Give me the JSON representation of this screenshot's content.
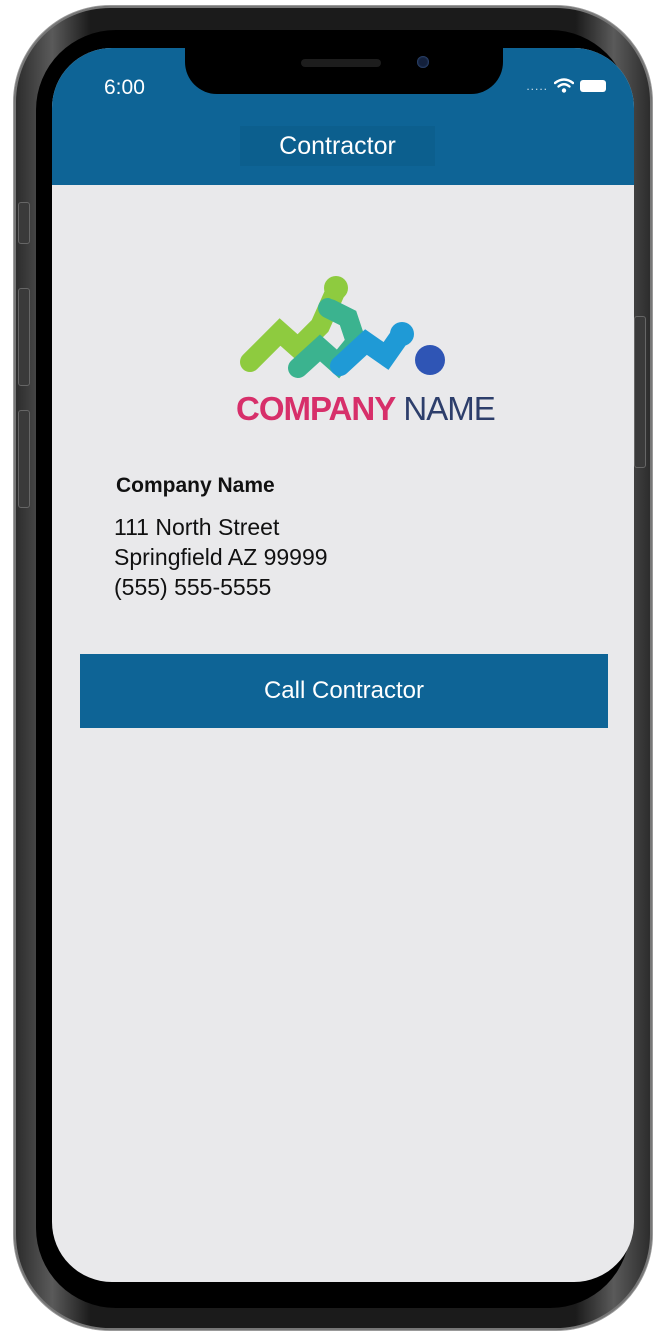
{
  "status_bar": {
    "time": "6:00",
    "signal_dots": "....."
  },
  "header": {
    "title": "Contractor"
  },
  "logo": {
    "word1": "COMPANY",
    "word2": "NAME",
    "colors": [
      "#8ecb3f",
      "#3bb38f",
      "#1f9ad6",
      "#2f55b5",
      "#d72f6a"
    ]
  },
  "company": {
    "name": "Company Name",
    "address_line1": "111 North Street",
    "address_line2": "Springfield AZ 99999",
    "phone": "(555) 555-5555"
  },
  "actions": {
    "call_label": "Call Contractor"
  },
  "colors": {
    "primary": "#0e6496",
    "background": "#e9e9eb",
    "accent": "#d72f6a"
  }
}
